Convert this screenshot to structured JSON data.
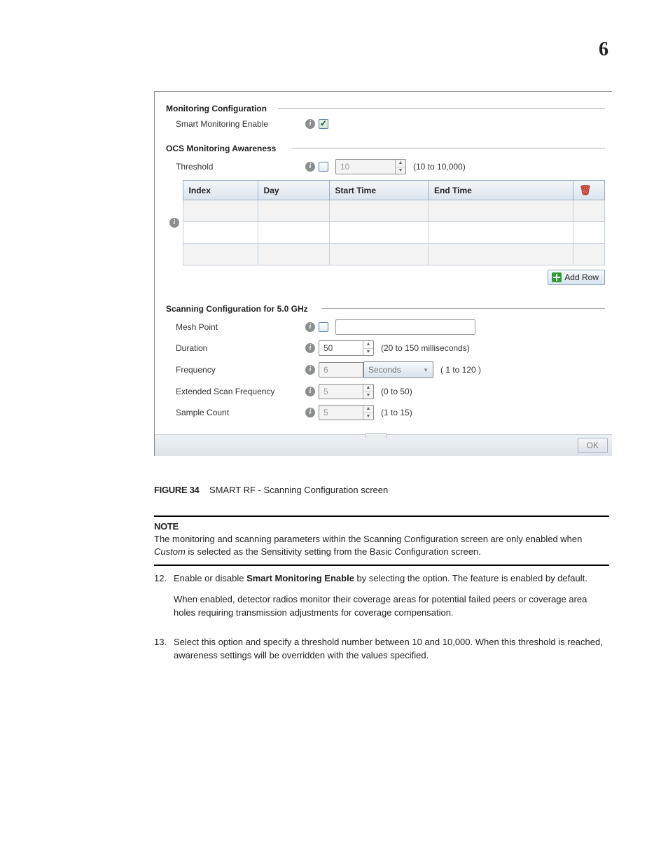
{
  "page_number": "6",
  "sections": {
    "monitoring": {
      "legend": "Monitoring Configuration",
      "smart_label": "Smart Monitoring Enable"
    },
    "ocs": {
      "legend": "OCS Monitoring Awareness",
      "threshold_label": "Threshold",
      "threshold_value": "10",
      "threshold_hint": "(10 to 10,000)",
      "headers": {
        "index": "Index",
        "day": "Day",
        "start": "Start Time",
        "end": "End Time"
      },
      "add_row": "Add Row"
    },
    "scan5": {
      "legend": "Scanning Configuration for 5.0 GHz",
      "mesh_label": "Mesh Point",
      "duration_label": "Duration",
      "duration_value": "50",
      "duration_hint": "(20 to 150 milliseconds)",
      "frequency_label": "Frequency",
      "frequency_value": "6",
      "frequency_unit": "Seconds",
      "frequency_hint": "( 1 to 120 )",
      "ext_label": "Extended Scan Frequency",
      "ext_value": "5",
      "ext_hint": "(0 to 50)",
      "sample_label": "Sample Count",
      "sample_value": "5",
      "sample_hint": "(1 to 15)"
    }
  },
  "ok_label": "OK",
  "figure": {
    "label": "FIGURE 34",
    "caption": "SMART RF - Scanning Configuration screen"
  },
  "note": {
    "heading": "NOTE",
    "text_a": "The monitoring and scanning parameters within the Scanning Configuration screen are only enabled when ",
    "text_em": "Custom",
    "text_b": " is selected as the Sensitivity setting from the Basic Configuration screen."
  },
  "steps": [
    {
      "n": "12.",
      "p1a": "Enable or disable ",
      "p1b": "Smart Monitoring Enable",
      "p1c": " by selecting the option. The feature is enabled by default.",
      "p2": "When enabled, detector radios monitor their coverage areas for potential failed peers or coverage area holes requiring transmission adjustments for coverage compensation."
    },
    {
      "n": "13.",
      "p1": "Select this option and specify a threshold number between 10 and 10,000. When this threshold is reached, awareness settings will be overridden with the values specified."
    }
  ]
}
